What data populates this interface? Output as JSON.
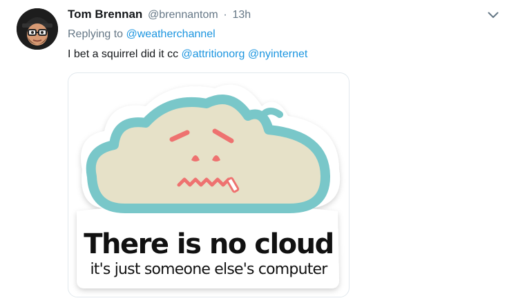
{
  "tweet": {
    "author_name": "Tom Brennan",
    "author_handle": "@brennantom",
    "separator": "·",
    "timestamp": "13h",
    "reply_prefix": "Replying to",
    "reply_to": "@weatherchannel",
    "text_before": "I bet a squirrel did it cc",
    "mention_1": "@attritionorg",
    "mention_2": "@nyinternet",
    "menu_icon": "chevron-down-icon"
  },
  "media": {
    "caption_main": "There is no cloud",
    "caption_sub": "it's just someone else's computer",
    "colors": {
      "cloud_fill": "#e6e1c8",
      "cloud_outline": "#79c7c9",
      "face": "#ee7270"
    }
  },
  "colors": {
    "link": "#1b95e0",
    "secondary_text": "#657786",
    "primary_text": "#14171a"
  }
}
